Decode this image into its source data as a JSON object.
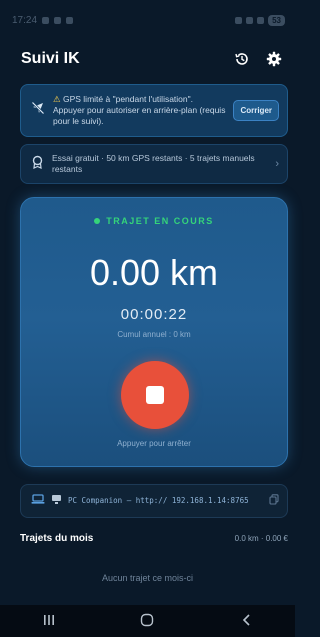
{
  "status_bar": {
    "time": "17:24",
    "battery": "53"
  },
  "app": {
    "title": "Suivi IK"
  },
  "gps_banner": {
    "warning_text": "GPS limité à \"pendant l'utilisation\". Appuyer pour autoriser en arrière-plan (requis pour le suivi).",
    "button_label": "Corriger"
  },
  "trial_banner": {
    "text": "Essai gratuit · 50 km GPS restants · 5 trajets manuels restants"
  },
  "trip": {
    "status": "TRAJET EN COURS",
    "distance": "0.00 km",
    "timer": "00:00:22",
    "cumul": "Cumul annuel : 0 km",
    "stop_hint": "Appuyer pour arrêter"
  },
  "pc_companion": {
    "text": "PC Companion — http:// 192.168.1.14:8765"
  },
  "month_trips": {
    "title": "Trajets du mois",
    "summary": "0.0 km · 0.00 €",
    "empty_message": "Aucun trajet ce mois-ci"
  },
  "colors": {
    "background": "#0a1929",
    "accent": "#1f5a8c",
    "status_green": "#35d47a",
    "stop_red": "#e8503a",
    "warning_yellow": "#f2c94c"
  }
}
